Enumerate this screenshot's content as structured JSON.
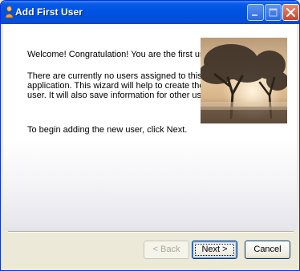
{
  "window": {
    "title": "Add First User",
    "icon": "user-wizard-icon"
  },
  "body": {
    "welcome": "Welcome!  Congratulation!  You are the first user.",
    "info_lines": [
      "There are currently no users assigned to this",
      "application.  This wizard will help to create the first",
      "user.  It will also save information for other users."
    ],
    "instruction": "To begin adding the new user, click Next."
  },
  "buttons": {
    "back_label": "< Back",
    "next_label": "Next >",
    "cancel_label": "Cancel"
  },
  "colors": {
    "titlebar": "#0054e3",
    "dialog_face": "#ece9d8",
    "close_button": "#c9452b"
  }
}
